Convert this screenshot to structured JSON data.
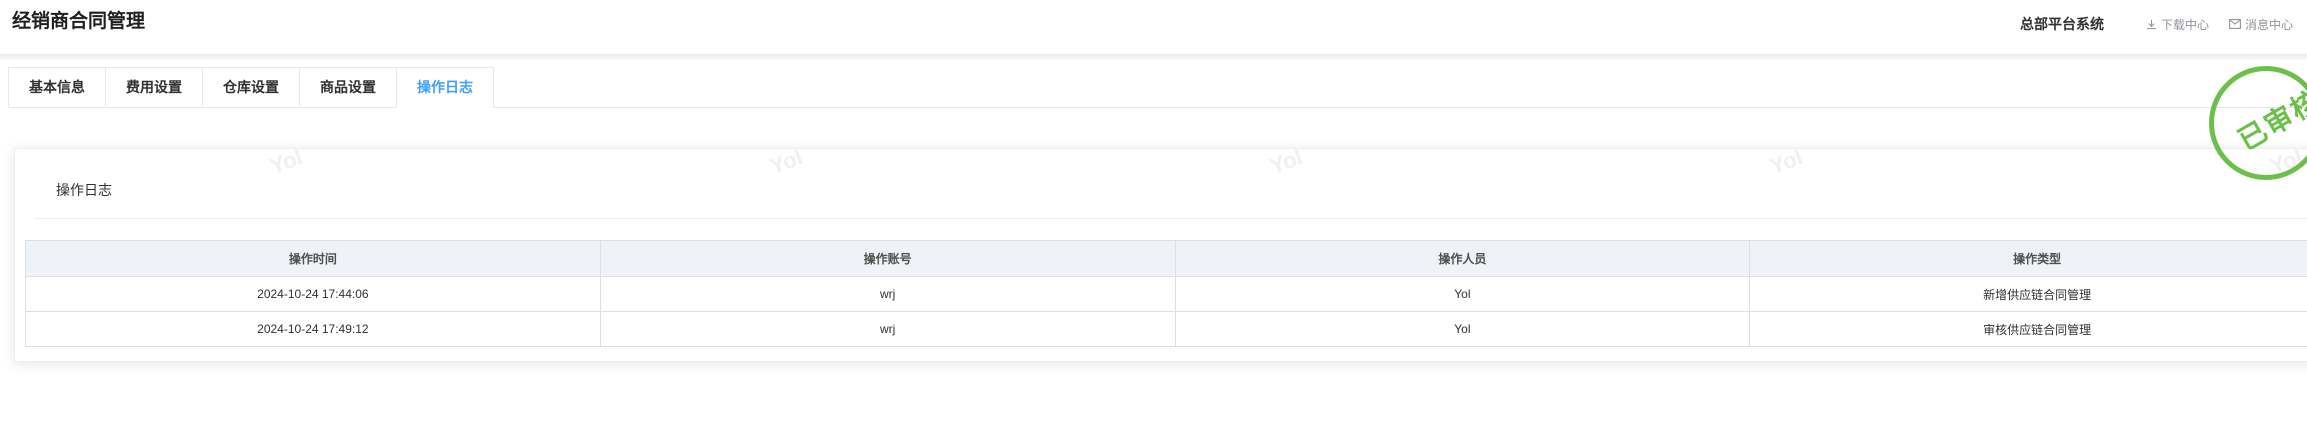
{
  "header": {
    "title": "经销商合同管理",
    "platform": "总部平台系统",
    "download_label": "下载中心",
    "message_label": "消息中心"
  },
  "tabs": [
    {
      "label": "基本信息",
      "active": false
    },
    {
      "label": "费用设置",
      "active": false
    },
    {
      "label": "仓库设置",
      "active": false
    },
    {
      "label": "商品设置",
      "active": false
    },
    {
      "label": "操作日志",
      "active": true
    }
  ],
  "section": {
    "title": "操作日志"
  },
  "table": {
    "headers": [
      "操作时间",
      "操作账号",
      "操作人员",
      "操作类型"
    ],
    "rows": [
      [
        "2024-10-24 17:44:06",
        "wrj",
        "Yol",
        "新增供应链合同管理"
      ],
      [
        "2024-10-24 17:49:12",
        "wrj",
        "Yol",
        "审核供应链合同管理"
      ]
    ]
  },
  "watermark": "Yol",
  "stamp": {
    "text": "已审核",
    "color": "#6cc04a"
  },
  "colors": {
    "accent": "#409eff",
    "table_header_bg": "#eff2f7"
  }
}
